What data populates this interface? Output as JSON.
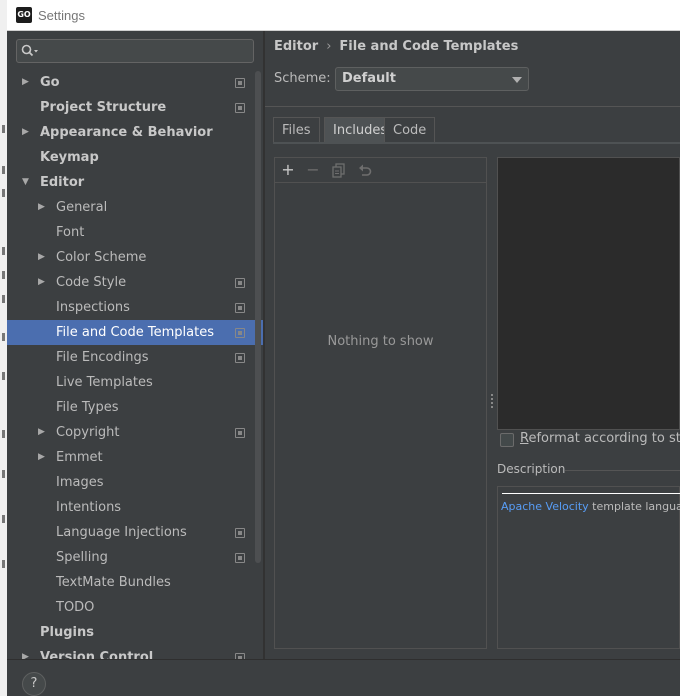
{
  "window": {
    "title": "Settings",
    "app_icon_text": "GO"
  },
  "search": {
    "placeholder": ""
  },
  "sidebar": {
    "items": [
      {
        "label": "Go",
        "level": 0,
        "arrow": "right",
        "bold": true,
        "project": true
      },
      {
        "label": "Project Structure",
        "level": 0,
        "arrow": "",
        "bold": true,
        "project": true
      },
      {
        "label": "Appearance & Behavior",
        "level": 0,
        "arrow": "right",
        "bold": true,
        "project": false
      },
      {
        "label": "Keymap",
        "level": 0,
        "arrow": "",
        "bold": true,
        "project": false
      },
      {
        "label": "Editor",
        "level": 0,
        "arrow": "down",
        "bold": true,
        "project": false
      },
      {
        "label": "General",
        "level": 1,
        "arrow": "right",
        "bold": false,
        "project": false
      },
      {
        "label": "Font",
        "level": 1,
        "arrow": "",
        "bold": false,
        "project": false
      },
      {
        "label": "Color Scheme",
        "level": 1,
        "arrow": "right",
        "bold": false,
        "project": false
      },
      {
        "label": "Code Style",
        "level": 1,
        "arrow": "right",
        "bold": false,
        "project": true
      },
      {
        "label": "Inspections",
        "level": 1,
        "arrow": "",
        "bold": false,
        "project": true
      },
      {
        "label": "File and Code Templates",
        "level": 1,
        "arrow": "",
        "bold": false,
        "project": true,
        "selected": true
      },
      {
        "label": "File Encodings",
        "level": 1,
        "arrow": "",
        "bold": false,
        "project": true
      },
      {
        "label": "Live Templates",
        "level": 1,
        "arrow": "",
        "bold": false,
        "project": false
      },
      {
        "label": "File Types",
        "level": 1,
        "arrow": "",
        "bold": false,
        "project": false
      },
      {
        "label": "Copyright",
        "level": 1,
        "arrow": "right",
        "bold": false,
        "project": true
      },
      {
        "label": "Emmet",
        "level": 1,
        "arrow": "right",
        "bold": false,
        "project": false
      },
      {
        "label": "Images",
        "level": 1,
        "arrow": "",
        "bold": false,
        "project": false
      },
      {
        "label": "Intentions",
        "level": 1,
        "arrow": "",
        "bold": false,
        "project": false
      },
      {
        "label": "Language Injections",
        "level": 1,
        "arrow": "",
        "bold": false,
        "project": true
      },
      {
        "label": "Spelling",
        "level": 1,
        "arrow": "",
        "bold": false,
        "project": true
      },
      {
        "label": "TextMate Bundles",
        "level": 1,
        "arrow": "",
        "bold": false,
        "project": false
      },
      {
        "label": "TODO",
        "level": 1,
        "arrow": "",
        "bold": false,
        "project": false
      },
      {
        "label": "Plugins",
        "level": 0,
        "arrow": "",
        "bold": true,
        "project": false
      },
      {
        "label": "Version Control",
        "level": 0,
        "arrow": "right",
        "bold": true,
        "project": true
      }
    ]
  },
  "breadcrumb": {
    "parent": "Editor",
    "separator": "›",
    "current": "File and Code Templates"
  },
  "scheme": {
    "label": "Scheme:",
    "value": "Default"
  },
  "tabs": [
    {
      "label": "Files",
      "active": false
    },
    {
      "label": "Includes",
      "active": true
    },
    {
      "label": "Code",
      "active": false
    }
  ],
  "list": {
    "empty_text": "Nothing to show",
    "toolbar": [
      "add-icon",
      "remove-icon",
      "copy-icon",
      "reset-icon"
    ]
  },
  "reformat": {
    "label": "Reformat according to style",
    "checked": false
  },
  "description": {
    "label": "Description",
    "link_text": "Apache Velocity",
    "text": " template language is used"
  },
  "help": {
    "label": "?"
  },
  "colors": {
    "selection": "#4b6eaf",
    "link": "#589df6",
    "background": "#3c3f41",
    "editor": "#2b2b2b"
  }
}
